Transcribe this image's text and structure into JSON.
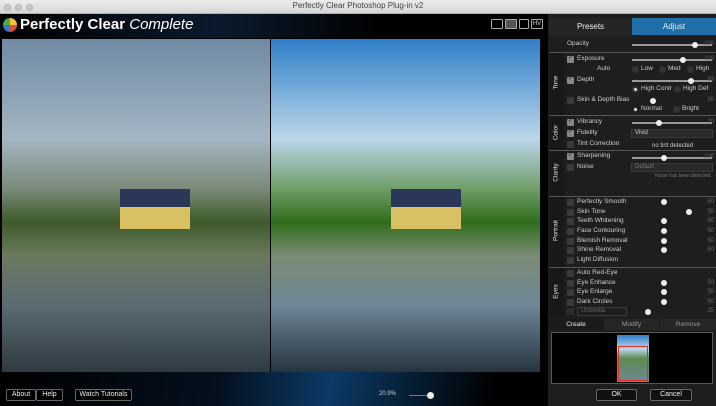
{
  "window": {
    "title": "Perfectly Clear Photoshop Plug-in v2"
  },
  "header": {
    "brand": "Perfectly Clear",
    "brand_suffix": "Complete",
    "view_modes": [
      "single-view",
      "side-by-side",
      "split-view",
      "HV"
    ]
  },
  "footer": {
    "about": "About",
    "help": "Help",
    "tutorials": "Watch Tutorials",
    "zoom": "20.9%",
    "zoom_value": 20.9
  },
  "panel": {
    "tabs": {
      "presets": "Presets",
      "adjust": "Adjust",
      "active": "Adjust"
    },
    "opacity": {
      "label": "Opacity",
      "value": "100"
    },
    "tone": {
      "label": "Tone",
      "exposure": {
        "label": "Exposure",
        "checked": true,
        "value": "119",
        "auto_label": "Auto",
        "options": [
          "Low",
          "Med",
          "High"
        ]
      },
      "depth": {
        "label": "Depth",
        "checked": true,
        "value": "93",
        "options": [
          "High Contr",
          "High Def"
        ],
        "selected": "High Contr"
      },
      "skin_depth": {
        "label": "Skin & Depth Bias",
        "checked": false,
        "value": "30",
        "options": [
          "Normal",
          "Bright"
        ],
        "selected": "Normal"
      }
    },
    "color": {
      "label": "Color",
      "vibrancy": {
        "label": "Vibrancy",
        "checked": true,
        "value": "20"
      },
      "fidelity": {
        "label": "Fidelity",
        "checked": true,
        "select": "Vivid"
      },
      "tint": {
        "label": "Tint Correction",
        "checked": false,
        "status": "no tint detected"
      }
    },
    "clarity": {
      "label": "Clarity",
      "sharpening": {
        "label": "Sharpening",
        "checked": true,
        "value": "100"
      },
      "noise": {
        "label": "Noise",
        "checked": false,
        "select": "Default",
        "status": "Noise has been detected."
      }
    },
    "portrait": {
      "label": "Portrait",
      "items": [
        {
          "label": "Perfectly Smooth",
          "value": "50"
        },
        {
          "label": "Skin Tone",
          "value": "50"
        },
        {
          "label": "Teeth Whitening",
          "value": "50"
        },
        {
          "label": "Face Contouring",
          "value": "50"
        },
        {
          "label": "Blemish Removal",
          "value": "50"
        },
        {
          "label": "Shine Removal",
          "value": "50"
        },
        {
          "label": "Light Diffusion",
          "value": ""
        }
      ]
    },
    "eyes": {
      "label": "Eyes",
      "items": [
        {
          "label": "Auto Red-Eye",
          "value": ""
        },
        {
          "label": "Eye Enhance",
          "value": "50"
        },
        {
          "label": "Eye Enlarge",
          "value": "50"
        },
        {
          "label": "Dark Circles",
          "value": "50"
        }
      ],
      "umbrella": {
        "select": "Umbrella",
        "value": "25"
      }
    },
    "bottom_tabs": {
      "create": "Create",
      "modify": "Modify",
      "remove": "Remove"
    },
    "ok": "OK",
    "cancel": "Cancel"
  },
  "colors": {
    "accent": "#1f6fa8",
    "panel_bg": "#1e1e1e",
    "selection": "#e03020"
  }
}
